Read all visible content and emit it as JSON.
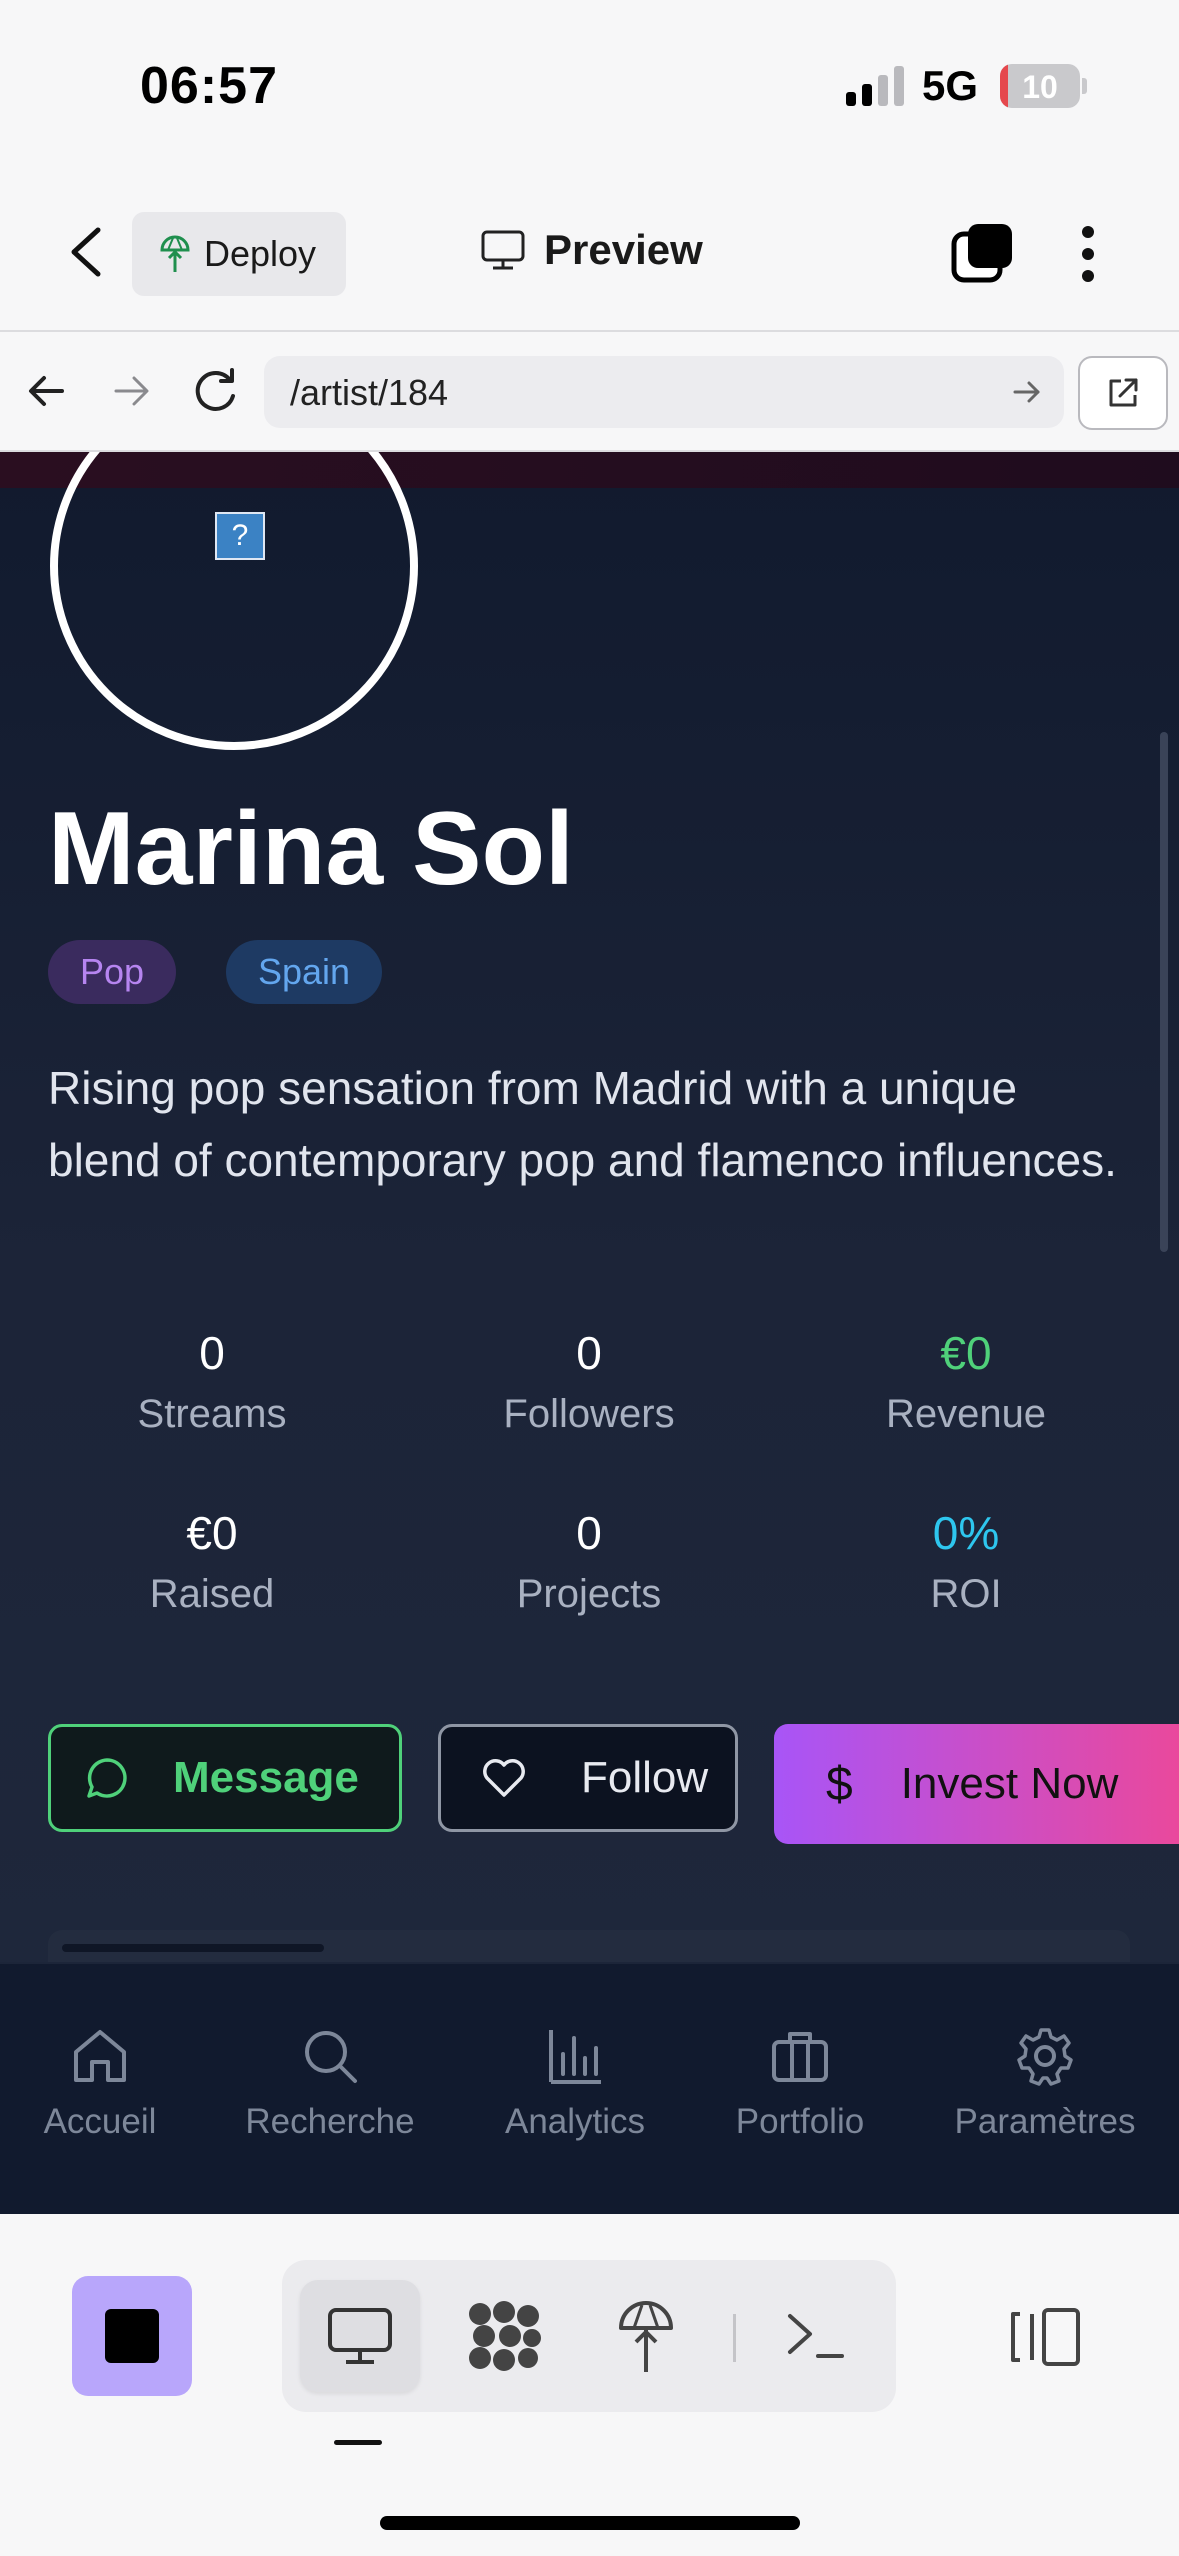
{
  "status_bar": {
    "time": "06:57",
    "network": "5G",
    "battery": "10",
    "battery_level": 0.1,
    "battery_color": "#e5484d"
  },
  "toolbar": {
    "deploy_label": "Deploy",
    "preview_label": "Preview"
  },
  "url_bar": {
    "url": "/artist/184"
  },
  "artist": {
    "name": "Marina Sol",
    "tags": {
      "genre": "Pop",
      "country": "Spain"
    },
    "bio": "Rising pop sensation from Madrid with a unique blend of contemporary pop and flamenco influences.",
    "avatar_placeholder": "?"
  },
  "stats": [
    {
      "value": "0",
      "label": "Streams"
    },
    {
      "value": "0",
      "label": "Followers"
    },
    {
      "value": "€0",
      "label": "Revenue"
    },
    {
      "value": "€0",
      "label": "Raised"
    },
    {
      "value": "0",
      "label": "Projects"
    },
    {
      "value": "0%",
      "label": "ROI"
    }
  ],
  "actions": {
    "message": "Message",
    "follow": "Follow",
    "invest_symbol": "$",
    "invest": "Invest Now"
  },
  "bottom_nav": [
    {
      "label": "Accueil",
      "icon": "home-icon"
    },
    {
      "label": "Recherche",
      "icon": "search-icon"
    },
    {
      "label": "Analytics",
      "icon": "bar-chart-icon"
    },
    {
      "label": "Portfolio",
      "icon": "briefcase-icon"
    },
    {
      "label": "Paramètres",
      "icon": "gear-icon"
    }
  ],
  "ide_toolbar": {
    "icons": [
      "stop-icon",
      "monitor-icon",
      "apps-icon",
      "deploy-icon",
      "terminal-icon",
      "split-view-icon"
    ]
  },
  "colors": {
    "accent_green": "#4fd17a",
    "accent_cyan": "#2ec6ee",
    "invest_gradient_start": "#a855f7",
    "invest_gradient_end": "#ec4899",
    "stop_button": "#b8a6fb"
  }
}
